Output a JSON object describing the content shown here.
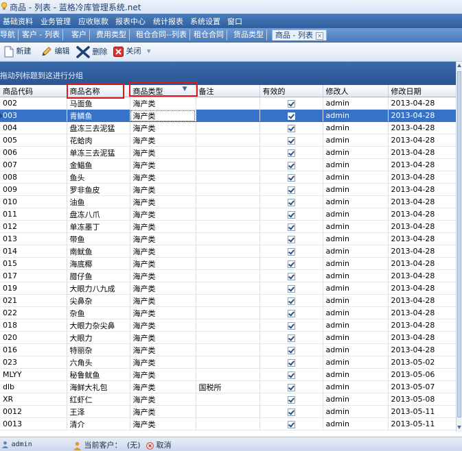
{
  "window": {
    "title": "商品 - 列表 - 蓝格冷库管理系统.net"
  },
  "menu": [
    "基础资料",
    "业务管理",
    "应收账款",
    "报表中心",
    "统计报表",
    "系统设置",
    "窗口"
  ],
  "tabs": [
    {
      "label": "导航"
    },
    {
      "label": "客户 - 列表"
    },
    {
      "label": "客户"
    },
    {
      "label": "费用类型"
    },
    {
      "label": "租仓合同--列表"
    },
    {
      "label": "租仓合同"
    },
    {
      "label": "货品类型"
    },
    {
      "label": "商品 - 列表",
      "active": true
    }
  ],
  "toolbar": {
    "new_label": "新建",
    "edit_label": "编辑",
    "delete_label": "删除",
    "close_label": "关闭"
  },
  "group_panel": {
    "hint": "拖动列标题到这进行分组"
  },
  "grid": {
    "columns": [
      "商品代码",
      "商品名称",
      "商品类型",
      "备注",
      "有效的",
      "修改人",
      "修改日期"
    ],
    "selected_row": 1,
    "rows": [
      {
        "code": "002",
        "name": "马面鱼",
        "type": "海产类",
        "note": "",
        "valid": true,
        "modifier": "admin",
        "date": "2013-04-28"
      },
      {
        "code": "003",
        "name": "青鳞鱼",
        "type": "海产类",
        "note": "",
        "valid": true,
        "modifier": "admin",
        "date": "2013-04-28"
      },
      {
        "code": "004",
        "name": "盘冻三去泥猛",
        "type": "海产类",
        "note": "",
        "valid": true,
        "modifier": "admin",
        "date": "2013-04-28"
      },
      {
        "code": "005",
        "name": "花蛤肉",
        "type": "海产类",
        "note": "",
        "valid": true,
        "modifier": "admin",
        "date": "2013-04-28"
      },
      {
        "code": "006",
        "name": "单冻三去泥猛",
        "type": "海产类",
        "note": "",
        "valid": true,
        "modifier": "admin",
        "date": "2013-04-28"
      },
      {
        "code": "007",
        "name": "金鲳鱼",
        "type": "海产类",
        "note": "",
        "valid": true,
        "modifier": "admin",
        "date": "2013-04-28"
      },
      {
        "code": "008",
        "name": "鱼头",
        "type": "海产类",
        "note": "",
        "valid": true,
        "modifier": "admin",
        "date": "2013-04-28"
      },
      {
        "code": "009",
        "name": "罗非鱼皮",
        "type": "海产类",
        "note": "",
        "valid": true,
        "modifier": "admin",
        "date": "2013-04-28"
      },
      {
        "code": "010",
        "name": "油鱼",
        "type": "海产类",
        "note": "",
        "valid": true,
        "modifier": "admin",
        "date": "2013-04-28"
      },
      {
        "code": "011",
        "name": "盘冻八爪",
        "type": "海产类",
        "note": "",
        "valid": true,
        "modifier": "admin",
        "date": "2013-04-28"
      },
      {
        "code": "012",
        "name": "单冻墨丁",
        "type": "海产类",
        "note": "",
        "valid": true,
        "modifier": "admin",
        "date": "2013-04-28"
      },
      {
        "code": "013",
        "name": "带鱼",
        "type": "海产类",
        "note": "",
        "valid": true,
        "modifier": "admin",
        "date": "2013-04-28"
      },
      {
        "code": "014",
        "name": "南鱿鱼",
        "type": "海产类",
        "note": "",
        "valid": true,
        "modifier": "admin",
        "date": "2013-04-28"
      },
      {
        "code": "015",
        "name": "海底椰",
        "type": "海产类",
        "note": "",
        "valid": true,
        "modifier": "admin",
        "date": "2013-04-28"
      },
      {
        "code": "017",
        "name": "腊仔鱼",
        "type": "海产类",
        "note": "",
        "valid": true,
        "modifier": "admin",
        "date": "2013-04-28"
      },
      {
        "code": "019",
        "name": "大眼力八九成",
        "type": "海产类",
        "note": "",
        "valid": true,
        "modifier": "admin",
        "date": "2013-04-28"
      },
      {
        "code": "021",
        "name": "尖鼻杂",
        "type": "海产类",
        "note": "",
        "valid": true,
        "modifier": "admin",
        "date": "2013-04-28"
      },
      {
        "code": "022",
        "name": "杂鱼",
        "type": "海产类",
        "note": "",
        "valid": true,
        "modifier": "admin",
        "date": "2013-04-28"
      },
      {
        "code": "018",
        "name": "大眼力杂尖鼻",
        "type": "海产类",
        "note": "",
        "valid": true,
        "modifier": "admin",
        "date": "2013-04-28"
      },
      {
        "code": "020",
        "name": "大眼力",
        "type": "海产类",
        "note": "",
        "valid": true,
        "modifier": "admin",
        "date": "2013-04-28"
      },
      {
        "code": "016",
        "name": "特丽杂",
        "type": "海产类",
        "note": "",
        "valid": true,
        "modifier": "admin",
        "date": "2013-04-28"
      },
      {
        "code": "023",
        "name": "六角头",
        "type": "海产类",
        "note": "",
        "valid": true,
        "modifier": "admin",
        "date": "2013-05-02"
      },
      {
        "code": "MLYY",
        "name": "秘鲁鱿鱼",
        "type": "海产类",
        "note": "",
        "valid": true,
        "modifier": "admin",
        "date": "2013-05-06"
      },
      {
        "code": "dlb",
        "name": "海鲜大礼包",
        "type": "海产类",
        "note": "国税所",
        "valid": true,
        "modifier": "admin",
        "date": "2013-05-07"
      },
      {
        "code": "XR",
        "name": "红虾仁",
        "type": "海产类",
        "note": "",
        "valid": true,
        "modifier": "admin",
        "date": "2013-05-08"
      },
      {
        "code": "0012",
        "name": "王泽",
        "type": "海产类",
        "note": "",
        "valid": true,
        "modifier": "admin",
        "date": "2013-05-11"
      },
      {
        "code": "0013",
        "name": "清介",
        "type": "海产类",
        "note": "",
        "valid": true,
        "modifier": "admin",
        "date": "2013-05-11"
      }
    ]
  },
  "status": {
    "user": "admin",
    "customer_label": "当前客户：",
    "customer_value": "(无)",
    "cancel_label": "取消"
  },
  "colors": {
    "menu_bg": "#2f5f9d",
    "selection": "#3673c8",
    "highlight_box": "#e0191f"
  }
}
